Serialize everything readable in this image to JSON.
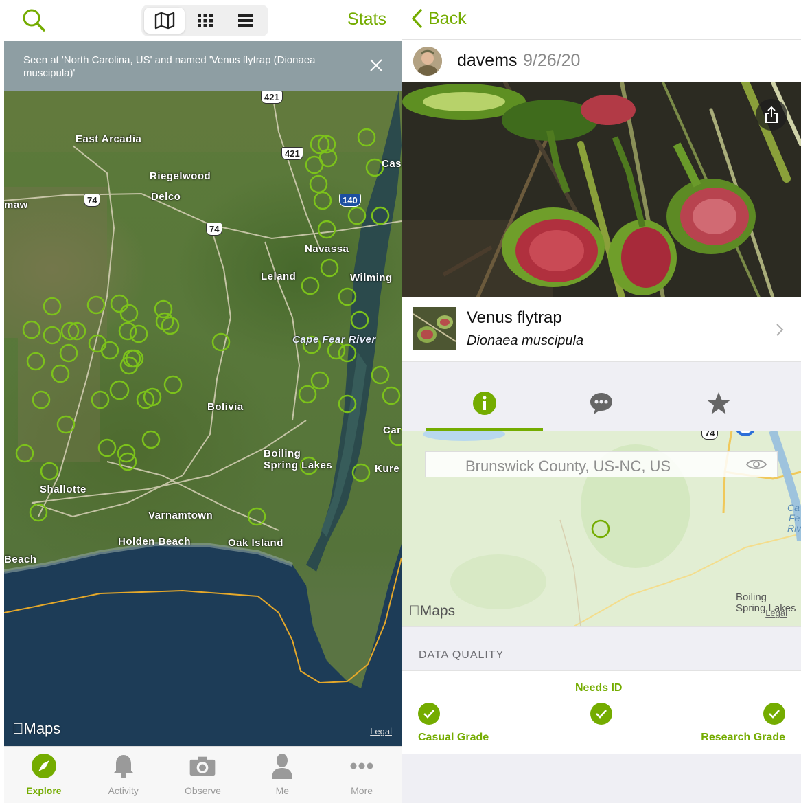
{
  "left": {
    "header": {
      "search_icon": "search-icon",
      "view_modes": [
        {
          "name": "map",
          "icon": "map-icon",
          "active": true
        },
        {
          "name": "grid",
          "icon": "grid-icon",
          "active": false
        },
        {
          "name": "list",
          "icon": "list-icon",
          "active": false
        }
      ],
      "stats_label": "Stats"
    },
    "banner": {
      "text": "Seen at 'North Carolina, US' and named 'Venus flytrap (Dionaea muscipula)'"
    },
    "map": {
      "places": {
        "east_arcadia": "East Arcadia",
        "riegelwood": "Riegelwood",
        "delco": "Delco",
        "maw": "maw",
        "navassa": "Navassa",
        "leland": "Leland",
        "wilming": "Wilming",
        "cape_fear": "Cape Fear River",
        "bolivia": "Bolivia",
        "boiling1": "Boiling",
        "boiling2": "Spring Lakes",
        "shallotte": "Shallotte",
        "varnamtown": "Varnamtown",
        "holden": "Holden Beach",
        "oak_island": "Oak Island",
        "beach": "Beach",
        "kure": "Kure",
        "cas": "Cas",
        "car": "Car"
      },
      "shields": {
        "r421": "421",
        "r74a": "74",
        "r74b": "74",
        "i140": "140",
        "r421top": "421"
      },
      "maps_logo": "Maps",
      "legal": "Legal"
    },
    "tabbar": [
      {
        "label": "Explore",
        "icon": "compass-icon",
        "active": true
      },
      {
        "label": "Activity",
        "icon": "bell-icon",
        "active": false
      },
      {
        "label": "Observe",
        "icon": "camera-icon",
        "active": false
      },
      {
        "label": "Me",
        "icon": "person-icon",
        "active": false
      },
      {
        "label": "More",
        "icon": "more-icon",
        "active": false
      }
    ]
  },
  "right": {
    "nav": {
      "back_label": "Back"
    },
    "observer": {
      "username": "davems",
      "date": "9/26/20"
    },
    "taxon": {
      "common_name": "Venus flytrap",
      "scientific_name": "Dionaea muscipula"
    },
    "detail_tabs": [
      {
        "name": "info",
        "icon": "info-icon",
        "active": true
      },
      {
        "name": "comments",
        "icon": "comment-icon",
        "active": false
      },
      {
        "name": "favorites",
        "icon": "star-icon",
        "active": false
      }
    ],
    "map": {
      "location": "Brunswick County, US-NC, US",
      "maps_logo": "Maps",
      "legal": "Legal",
      "boiling1": "Boiling",
      "boiling2": "Spring Lakes",
      "shield74": "74",
      "cfr1": "Ca",
      "cfr2": "Fe",
      "cfr3": "Riv"
    },
    "data_quality": {
      "title": "DATA QUALITY",
      "casual": "Casual Grade",
      "needs_id": "Needs ID",
      "research": "Research Grade"
    }
  },
  "colors": {
    "accent": "#74ac00",
    "banner_bg": "#8e9ea3",
    "section_bg": "#efeff4"
  }
}
